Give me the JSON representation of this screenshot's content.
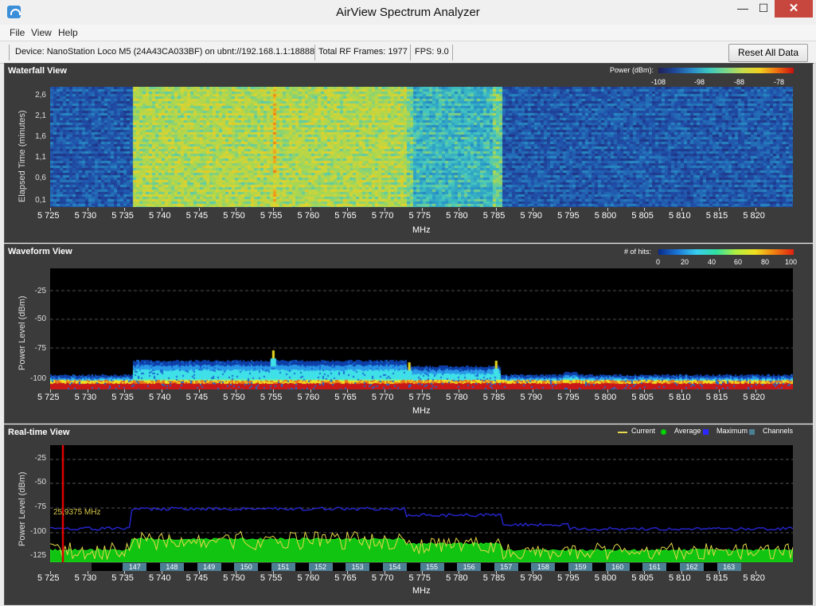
{
  "window": {
    "title": "AirView Spectrum Analyzer",
    "minimize": "—",
    "maximize": "☐",
    "close": "✕"
  },
  "menu": {
    "items": [
      "File",
      "View",
      "Help"
    ]
  },
  "device_bar": {
    "device": "Device: NanoStation Loco M5 (24A43CA033BF) on ubnt://192.168.1.1:18888",
    "frames": "Total RF Frames: 1977",
    "fps": "FPS: 9.0",
    "reset_label": "Reset All Data"
  },
  "x_axis": {
    "ticks": [
      "5 725",
      "5 730",
      "5 735",
      "5 740",
      "5 745",
      "5 750",
      "5 755",
      "5 760",
      "5 765",
      "5 770",
      "5 775",
      "5 780",
      "5 785",
      "5 790",
      "5 795",
      "5 800",
      "5 805",
      "5 810",
      "5 815",
      "5 820"
    ],
    "label": "MHz"
  },
  "waterfall": {
    "title": "Waterfall View",
    "legend_label": "Power (dBm):",
    "legend_ticks": [
      "-108",
      "-98",
      "-88",
      "-78"
    ],
    "ylabel": "Elapsed Time (minutes)",
    "yticks": [
      "2,6",
      "2,1",
      "1,6",
      "1,1",
      "0,6",
      "0,1"
    ]
  },
  "waveform": {
    "title": "Waveform View",
    "legend_label": "# of hits:",
    "legend_ticks": [
      "0",
      "20",
      "40",
      "60",
      "80",
      "100"
    ],
    "ylabel": "Power Level (dBm)",
    "yticks": [
      "-25",
      "-50",
      "-75",
      "-100"
    ]
  },
  "realtime": {
    "title": "Real-time View",
    "legend": [
      {
        "label": "Current",
        "color": "#e6d84a"
      },
      {
        "label": "Average",
        "color": "#00d000"
      },
      {
        "label": "Maximum",
        "color": "#2a2aff"
      },
      {
        "label": "Channels",
        "color": "#4c7e94"
      }
    ],
    "ylabel": "Power Level (dBm)",
    "yticks": [
      "-25",
      "-50",
      "-75",
      "-100",
      "-125"
    ],
    "cursor_label": "25,9375 MHz",
    "channels": [
      "147",
      "148",
      "149",
      "150",
      "151",
      "152",
      "153",
      "154",
      "155",
      "156",
      "157",
      "158",
      "159",
      "160",
      "161",
      "162",
      "163"
    ]
  },
  "colors": {
    "panel": "#3b3b3b",
    "plot": "#000000",
    "marker": "#e00000"
  }
}
